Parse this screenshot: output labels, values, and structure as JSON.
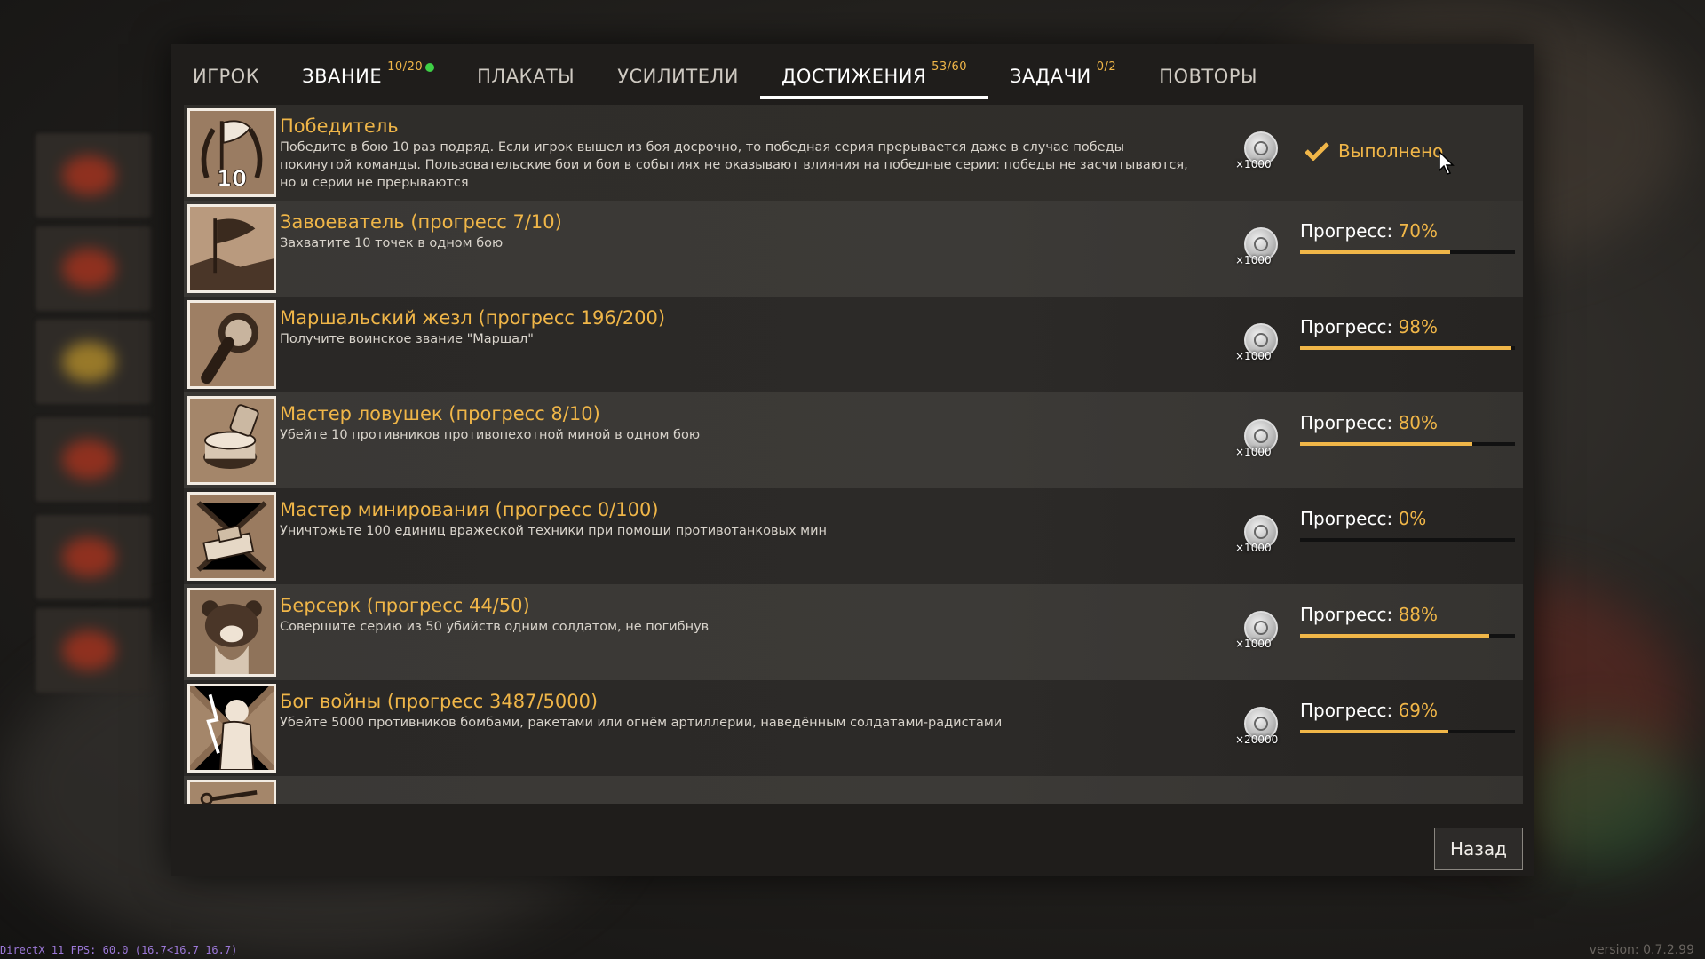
{
  "tabs": [
    {
      "label": "ИГРОК",
      "badge": ""
    },
    {
      "label": "ЗВАНИЕ",
      "badge": "10/20"
    },
    {
      "label": "ПЛАКАТЫ",
      "badge": ""
    },
    {
      "label": "УСИЛИТЕЛИ",
      "badge": ""
    },
    {
      "label": "ДОСТИЖЕНИЯ",
      "badge": "53/60"
    },
    {
      "label": "ЗАДАЧИ",
      "badge": "0/2"
    },
    {
      "label": "ПОВТОРЫ",
      "badge": ""
    }
  ],
  "active_tab": "ДОСТИЖЕНИЯ",
  "achievements": [
    {
      "title": "Победитель",
      "description": "Победите в бою 10 раз подряд. Если игрок вышел из боя досрочно, то победная серия прерывается даже в случае победы покинутой команды. Пользовательские бои и бои в событиях не оказывают влияния на победные серии: победы не засчитываются, но и серии не прерываются",
      "reward": "×1000",
      "status": "Выполнено",
      "icon": "flag-laurel-10-icon",
      "icon_number": "10"
    },
    {
      "title": "Завоеватель (прогресс 7/10)",
      "description": "Захватите 10 точек в одном бою",
      "reward": "×1000",
      "progress_label": "Прогресс:",
      "progress_pct": "70%",
      "progress": 0.7,
      "icon": "flag-icon"
    },
    {
      "title": "Маршальский жезл (прогресс 196/200)",
      "description": "Получите воинское звание \"Маршал\"",
      "reward": "×1000",
      "progress_label": "Прогресс:",
      "progress_pct": "98%",
      "progress": 0.98,
      "icon": "marshal-baton-icon"
    },
    {
      "title": "Мастер ловушек (прогресс 8/10)",
      "description": "Убейте 10 противников противопехотной миной в одном бою",
      "reward": "×1000",
      "progress_label": "Прогресс:",
      "progress_pct": "80%",
      "progress": 0.8,
      "icon": "landmine-icon"
    },
    {
      "title": "Мастер минирования (прогресс 0/100)",
      "description": "Уничтожьте 100 единиц вражеской техники при помощи противотанковых мин",
      "reward": "×1000",
      "progress_label": "Прогресс:",
      "progress_pct": "0%",
      "progress": 0.0,
      "icon": "tank-explosion-icon"
    },
    {
      "title": "Берсерк (прогресс 44/50)",
      "description": "Совершите серию из 50 убийств одним солдатом, не погибнув",
      "reward": "×1000",
      "progress_label": "Прогресс:",
      "progress_pct": "88%",
      "progress": 0.88,
      "icon": "bear-warrior-icon"
    },
    {
      "title": "Бог войны (прогресс 3487/5000)",
      "description": "Убейте 5000 противников бомбами, ракетами или огнём артиллерии, наведённым солдатами-радистами",
      "reward": "×20000",
      "progress_label": "Прогресс:",
      "progress_pct": "69%",
      "progress": 0.69,
      "icon": "zeus-lightning-icon"
    }
  ],
  "back_button": "Назад",
  "fps_text": "DirectX 11 FPS: 60.0 (16.7<16.7 16.7)",
  "version_text": "version: 0.7.2.99",
  "colors": {
    "accent": "#f0b648",
    "check_green": "#3ed046"
  }
}
